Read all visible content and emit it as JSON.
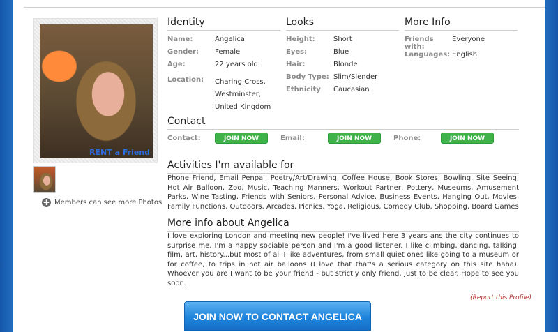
{
  "photo": {
    "watermark": "RENT a Friend",
    "more_photos": "Members can see more Photos"
  },
  "identity": {
    "title": "Identity",
    "name_label": "Name:",
    "name": "Angelica",
    "gender_label": "Gender:",
    "gender": "Female",
    "age_label": "Age:",
    "age": "22 years old",
    "location_label": "Location:",
    "location_lines": [
      "Charing Cross,",
      "Westminster,",
      "United Kingdom"
    ]
  },
  "looks": {
    "title": "Looks",
    "height_label": "Height:",
    "height": "Short",
    "eyes_label": "Eyes:",
    "eyes": "Blue",
    "hair_label": "Hair:",
    "hair": "Blonde",
    "body_label": "Body Type:",
    "body": "Slim/Slender",
    "ethnicity_label": "Ethnicity",
    "ethnicity": "Caucasian"
  },
  "more_info": {
    "title": "More Info",
    "friends_label": "Friends with:",
    "friends": "Everyone",
    "languages_label": "Languages:",
    "languages": "English"
  },
  "contact": {
    "title": "Contact",
    "contact_label": "Contact:",
    "email_label": "Email:",
    "phone_label": "Phone:",
    "join_label": "JOIN NOW"
  },
  "activities": {
    "title": "Activities I'm available for",
    "text": "Phone Friend, Email Penpal, Poetry/Art/Drawing, Coffee House, Book Stores, Bowling, Site Seeing, Hot Air Balloon, Zoo, Music, Teaching Manners, Workout Partner, Pottery, Museums, Amusement Parks, Wine Tasting, Friends with Seniors, Personal Advice, Business Events, Hanging Out, Movies, Family Functions, Outdoors, Arcades, Picnics, Yoga, Religious, Comedy Club, Shopping, Board Games"
  },
  "about": {
    "title": "More info about Angelica",
    "text": "I love exploring London and meeting new people! I've lived here 3 years ans the city continues to surprise me. I'm a happy sociable person and I'm a good listener. I like climbing, dancing, talking, film, art, history...but most of all I like adventures, from small quiet ones like going to a museum or for coffee, to trips in hot air balloons (I love that that's a serious category on this site haha). Whoever you are I want to be your friend - but strictly only friend, just to be clear. Hope to see you soon."
  },
  "report_link": "(Report this Profile)",
  "cta_button": "JOIN NOW TO CONTACT ANGELICA"
}
